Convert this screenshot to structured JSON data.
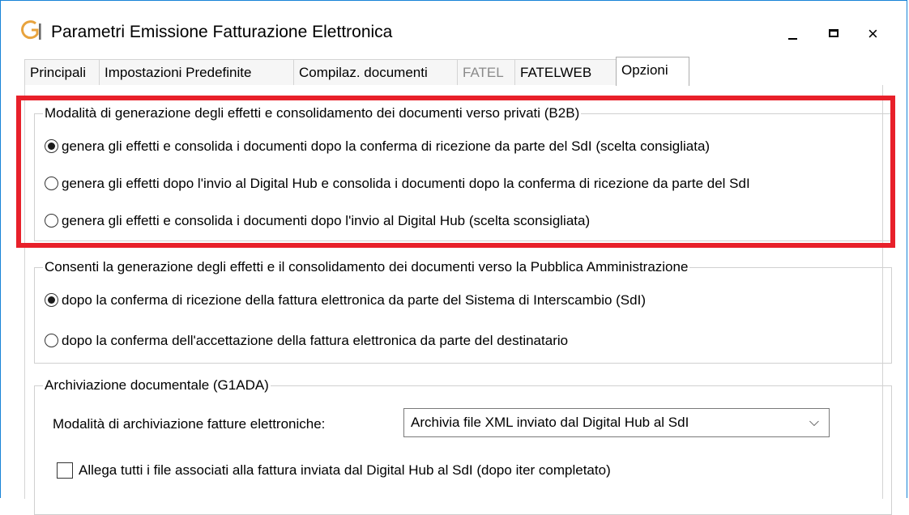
{
  "window": {
    "icon": "g1-app-icon",
    "title": "Parametri Emissione Fatturazione Elettronica",
    "controls": {
      "minimize": "minimize-icon",
      "maximize": "maximize-icon",
      "close": "×"
    }
  },
  "tabs": [
    {
      "label": "Principali",
      "state": "normal"
    },
    {
      "label": "Impostazioni Predefinite",
      "state": "normal"
    },
    {
      "label": "Compilaz. documenti",
      "state": "normal"
    },
    {
      "label": "FATEL",
      "state": "disabled"
    },
    {
      "label": "FATELWEB",
      "state": "normal"
    },
    {
      "label": "Opzioni",
      "state": "active"
    }
  ],
  "b2b": {
    "title": "Modalità di generazione degli effetti e consolidamento dei documenti verso privati (B2B)",
    "options": [
      {
        "label": "genera gli effetti e consolida i documenti dopo la conferma di ricezione da parte del SdI (scelta consigliata)",
        "checked": true
      },
      {
        "label": "genera gli effetti dopo l'invio al Digital Hub e consolida i documenti dopo la conferma di ricezione da parte del SdI",
        "checked": false
      },
      {
        "label": "genera gli effetti e consolida i documenti dopo l'invio al Digital Hub (scelta sconsigliata)",
        "checked": false
      }
    ],
    "highlight_color": "#e8202a"
  },
  "pa": {
    "title": "Consenti la generazione degli effetti e il consolidamento dei documenti verso la Pubblica Amministrazione",
    "options": [
      {
        "label": "dopo la conferma di ricezione della fattura elettronica da parte del Sistema di Interscambio (SdI)",
        "checked": true
      },
      {
        "label": "dopo la conferma dell'accettazione della fattura elettronica da parte del destinatario",
        "checked": false
      }
    ]
  },
  "archive": {
    "title": "Archiviazione documentale (G1ADA)",
    "mode_label": "Modalità di archiviazione fatture elettroniche:",
    "mode_value": "Archivia file XML inviato dal Digital Hub al SdI",
    "mode_chevron": "⌵",
    "attach_label": "Allega tutti i file associati alla fattura inviata dal Digital Hub al SdI (dopo iter completato)",
    "attach_checked": false
  },
  "colors": {
    "accent": "#1883d7",
    "icon_orange": "#e8a33d",
    "highlight": "#e8202a"
  }
}
